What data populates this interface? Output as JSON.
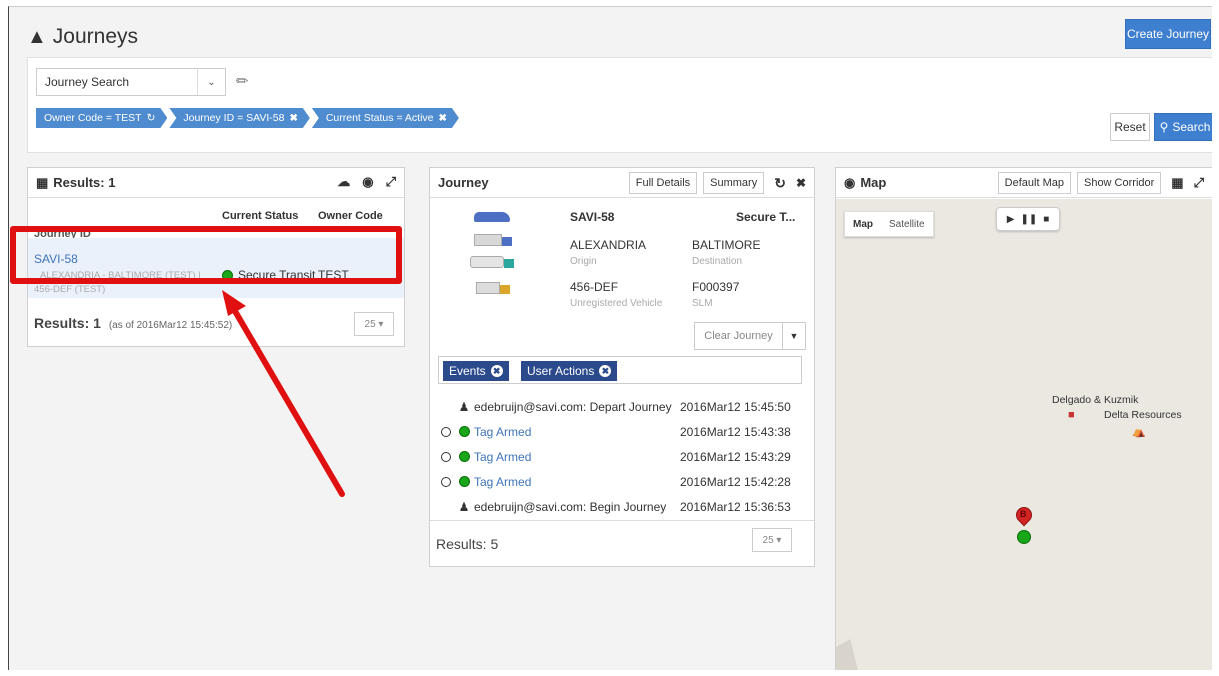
{
  "header": {
    "title": "Journeys",
    "create_label": "Create Journey"
  },
  "search": {
    "select_value": "Journey Search",
    "chips": [
      "Owner Code = TEST",
      "Journey ID = SAVI-58",
      "Current Status = Active"
    ],
    "reset_label": "Reset",
    "search_label": "Search"
  },
  "results": {
    "title": "Results: 1",
    "col_journey": "Journey ID",
    "col_status": "Current Status",
    "col_owner": "Owner Code",
    "row": {
      "id": "SAVI-58",
      "sub1": "ALEXANDRIA - BALTIMORE (TEST) |",
      "sub2": "456-DEF (TEST)",
      "status": "Secure Transit",
      "owner": "TEST"
    },
    "footer_label": "Results: 1",
    "footer_asof": "(as of 2016Mar12 15:45:52)",
    "page_size": "25 ▾"
  },
  "journey": {
    "title": "Journey",
    "full_details": "Full Details",
    "summary": "Summary",
    "id": "SAVI-58",
    "status": "Secure T...",
    "origin": "ALEXANDRIA",
    "origin_label": "Origin",
    "destination": "BALTIMORE",
    "destination_label": "Destination",
    "vehicle": "456-DEF",
    "vehicle_label": "Unregistered Vehicle",
    "tag": "F000397",
    "tag_label": "SLM",
    "clear_label": "Clear Journey",
    "tabs": [
      "Events",
      "User Actions"
    ],
    "events": [
      {
        "desc": "edebruijn@savi.com: Depart Journey",
        "ts": "2016Mar12 15:45:50",
        "kind": "user"
      },
      {
        "desc": "Tag Armed",
        "ts": "2016Mar12 15:43:38",
        "kind": "tag"
      },
      {
        "desc": "Tag Armed",
        "ts": "2016Mar12 15:43:29",
        "kind": "tag"
      },
      {
        "desc": "Tag Armed",
        "ts": "2016Mar12 15:42:28",
        "kind": "tag"
      },
      {
        "desc": "edebruijn@savi.com: Begin Journey",
        "ts": "2016Mar12 15:36:53",
        "kind": "user"
      }
    ],
    "footer_label": "Results: 5",
    "page_size": "25 ▾"
  },
  "map": {
    "title": "Map",
    "default_map": "Default Map",
    "show_corridor": "Show Corridor",
    "map_toggle": [
      "Map",
      "Satellite"
    ],
    "poi1": "Delgado & Kuzmik",
    "poi2": "Delta Resources",
    "marker_letter": "B"
  },
  "colors": {
    "primary": "#3f7fcf",
    "chip": "#4f8ccf",
    "tab": "#2b4a8c",
    "highlight": "#e01010",
    "status_green": "#19a619"
  }
}
